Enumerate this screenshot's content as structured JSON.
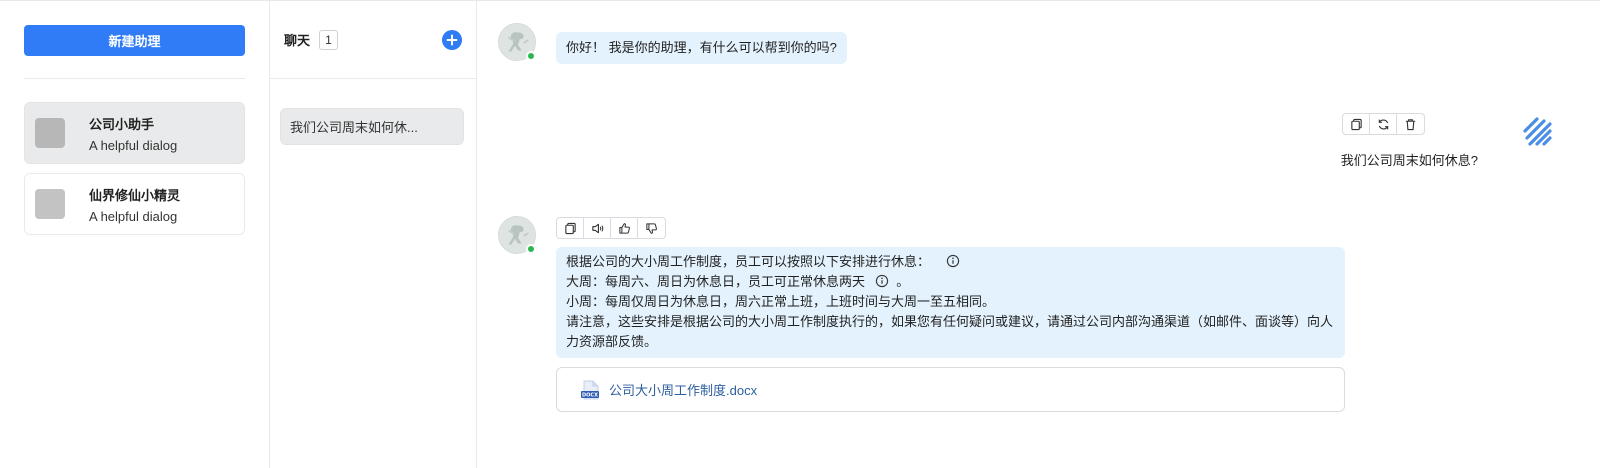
{
  "sidebar": {
    "new_button_label": "新建助理",
    "assistants": [
      {
        "name": "公司小助手",
        "description": "A helpful dialog",
        "active": true
      },
      {
        "name": "仙界修仙小精灵",
        "description": "A helpful dialog",
        "active": false
      }
    ]
  },
  "conversations": {
    "title": "聊天",
    "count": "1",
    "items": [
      {
        "title": "我们公司周末如何休..."
      }
    ]
  },
  "chat": {
    "greeting": "你好！ 我是你的助理，有什么可以帮到你的吗?",
    "user_message": "我们公司周末如何休息?",
    "answer": {
      "line1": "根据公司的大小周工作制度，员工可以按照以下安排进行休息：",
      "line2": "大周：每周六、周日为休息日，员工可正常休息两天",
      "line2_suffix": "。",
      "line3": "小周：每周仅周日为休息日，周六正常上班，上班时间与大周一至五相同。",
      "line4": "请注意，这些安排是根据公司的大小周工作制度执行的，如果您有任何疑问或建议，请通过公司内部沟通渠道（如邮件、面谈等）向人力资源部反馈。"
    },
    "attachment": {
      "filename": "公司大小周工作制度.docx",
      "icon_label": "DOCX"
    },
    "colors": {
      "accent": "#2f7cf6",
      "bubble": "#e3f2fc",
      "online": "#2bb74f"
    }
  }
}
